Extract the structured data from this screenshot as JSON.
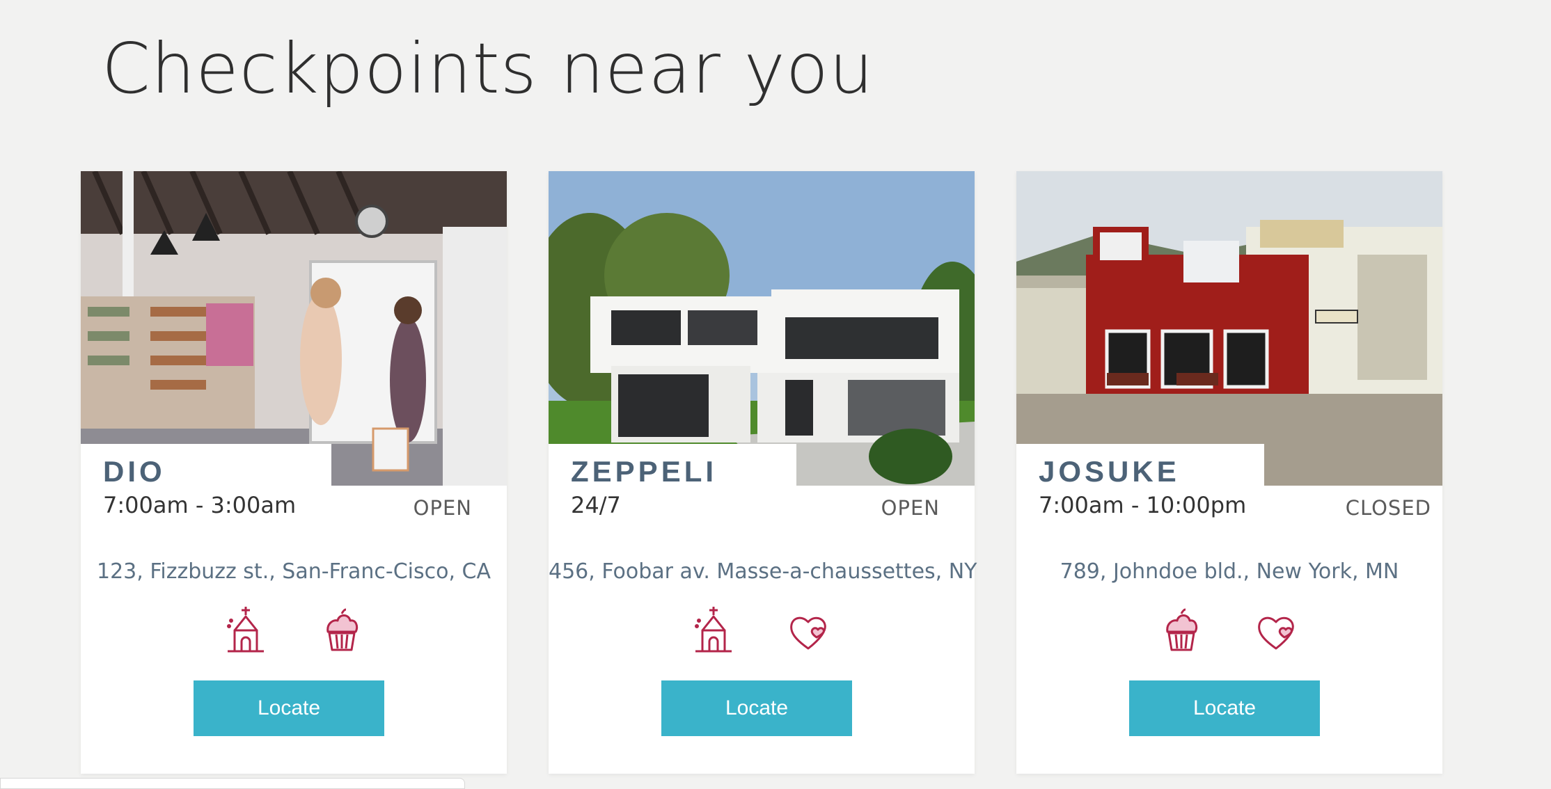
{
  "page": {
    "title": "Checkpoints near you"
  },
  "colors": {
    "accent": "#3ab3ca",
    "name": "#4c6277",
    "icon": "#b3254a"
  },
  "cards": [
    {
      "name": "DIO",
      "hours": "7:00am - 3:00am",
      "status": "OPEN",
      "address": "123, Fizzbuzz st., San-Franc-Cisco, CA",
      "amenities": [
        "church-icon",
        "cupcake-icon"
      ],
      "button": "Locate"
    },
    {
      "name": "ZEPPELI",
      "hours": "24/7",
      "status": "OPEN",
      "address": "456, Foobar av. Masse-a-chaussettes, NY",
      "amenities": [
        "church-icon",
        "heart-icon"
      ],
      "button": "Locate"
    },
    {
      "name": "JOSUKE",
      "hours": "7:00am - 10:00pm",
      "status": "CLOSED",
      "address": "789, Johndoe bld., New York, MN",
      "amenities": [
        "cupcake-icon",
        "heart-icon"
      ],
      "button": "Locate"
    }
  ]
}
